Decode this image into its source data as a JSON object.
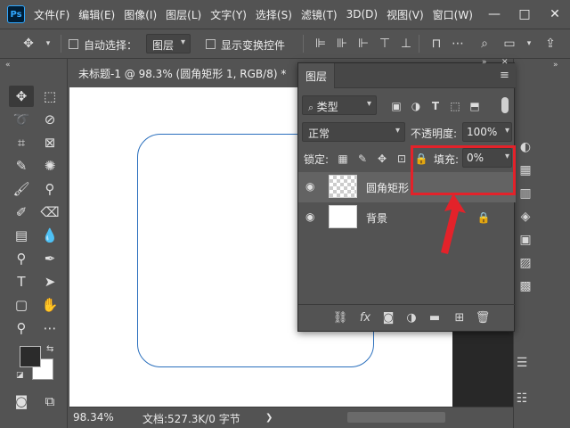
{
  "menubar": {
    "logo": "Ps",
    "items": [
      "文件(F)",
      "编辑(E)",
      "图像(I)",
      "图层(L)",
      "文字(Y)",
      "选择(S)",
      "滤镜(T)",
      "3D(D)",
      "视图(V)",
      "窗口(W)"
    ],
    "window_controls": [
      "—",
      "□",
      "✕"
    ]
  },
  "options": {
    "auto_select_label": "自动选择：",
    "auto_select_value": "图层",
    "show_transform_label": "显示变换控件"
  },
  "document": {
    "tab_title": "未标题-1 @ 98.3% (圆角矩形 1, RGB/8) *",
    "close": "✕"
  },
  "status": {
    "zoom": "98.34%",
    "doc_info": "文档:527.3K/0 字节",
    "arrow": "❯"
  },
  "layers_panel": {
    "tab_label": "图层",
    "kind_filter": "类型",
    "blend_mode": "正常",
    "opacity_label": "不透明度:",
    "opacity_value": "100%",
    "lock_label": "锁定:",
    "fill_label": "填充:",
    "fill_value": "0%",
    "fill_slider_fraction": 0,
    "layers": [
      {
        "name": "圆角矩形",
        "type": "shape",
        "visible": true
      },
      {
        "name": "背景",
        "type": "background",
        "visible": true,
        "locked": true
      }
    ]
  },
  "colors": {
    "highlight": "#e3222a",
    "shape_stroke": "#2a6fbd",
    "ui_bg": "#535353"
  }
}
